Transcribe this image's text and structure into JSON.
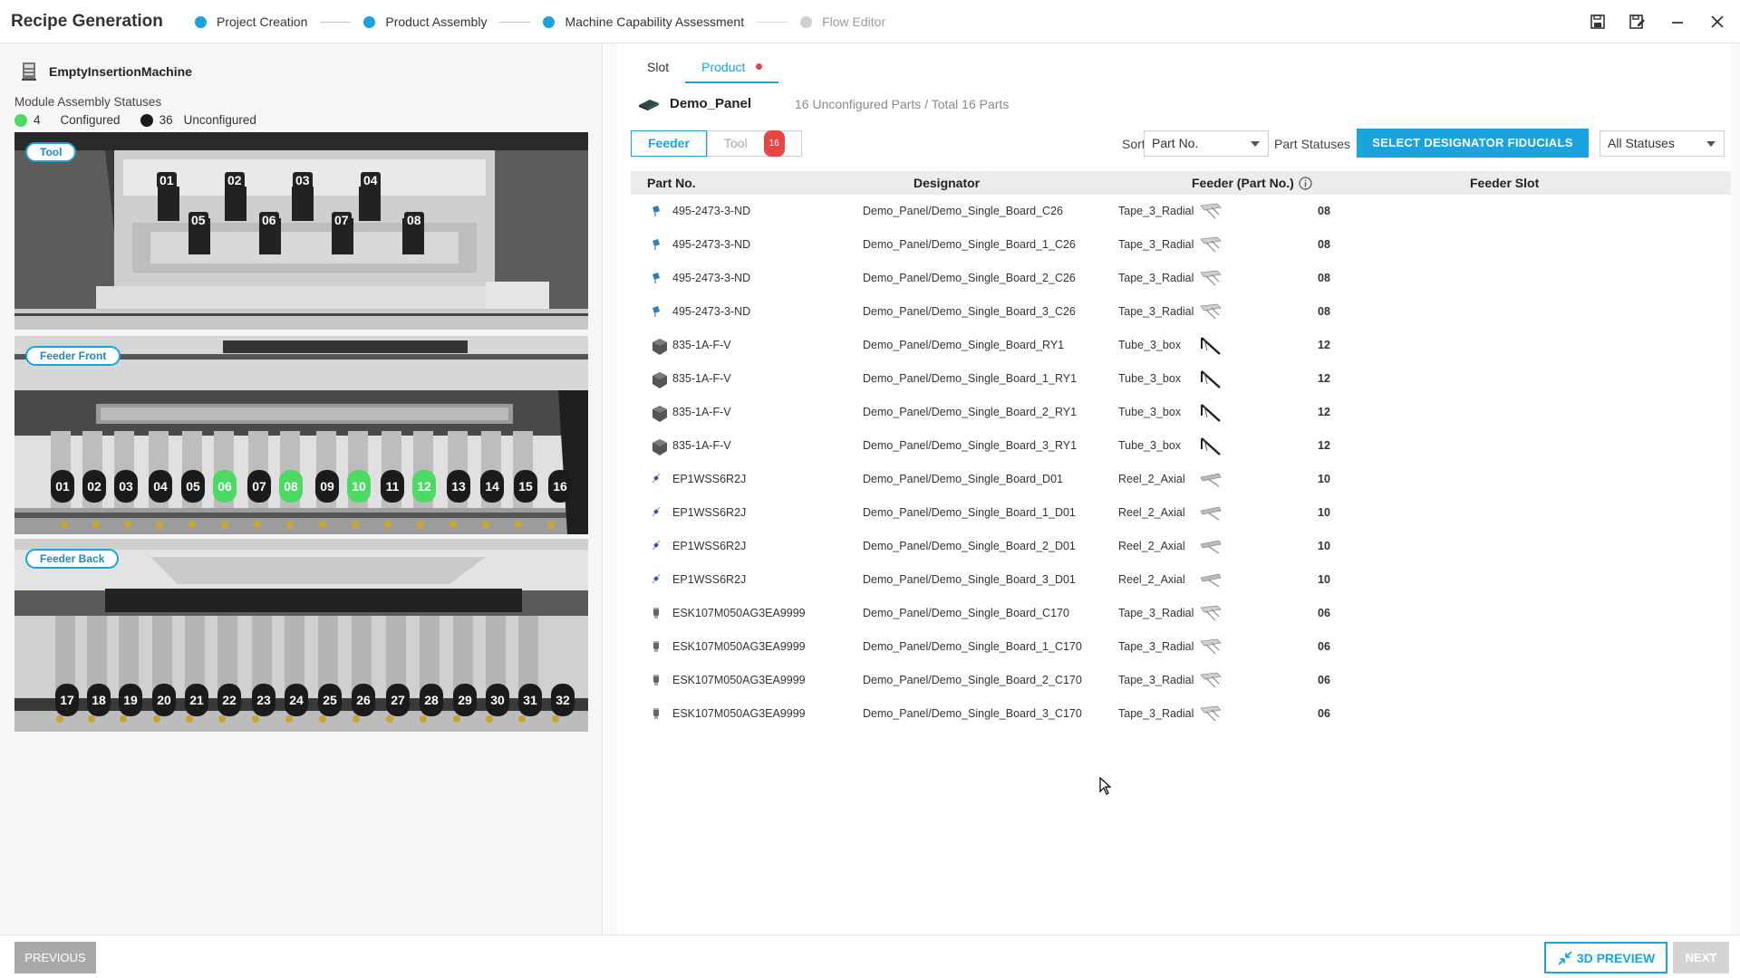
{
  "header": {
    "title": "Recipe Generation",
    "steps": [
      {
        "label": "Project Creation",
        "state": "done"
      },
      {
        "label": "Product Assembly",
        "state": "done"
      },
      {
        "label": "Machine Capability Assessment",
        "state": "current"
      },
      {
        "label": "Flow Editor",
        "state": "inactive"
      }
    ],
    "controls": [
      "save-icon",
      "save-as-icon",
      "minimize-icon",
      "close-icon"
    ]
  },
  "left": {
    "machine_name": "EmptyInsertionMachine",
    "status_title": "Module Assembly Statuses",
    "configured_count": "4",
    "configured_label": "Configured",
    "unconfigured_count": "36",
    "unconfigured_label": "Unconfigured",
    "configured_color": "#4cd964",
    "unconfigured_color": "#1b1b1b",
    "views": {
      "tool": {
        "label": "Tool",
        "slots": [
          "01",
          "02",
          "03",
          "04",
          "05",
          "06",
          "07",
          "08"
        ]
      },
      "front": {
        "label": "Feeder Front",
        "slots": [
          "01",
          "02",
          "03",
          "04",
          "05",
          "06",
          "07",
          "08",
          "09",
          "10",
          "11",
          "12",
          "13",
          "14",
          "15",
          "16"
        ],
        "configured": [
          "06",
          "08",
          "10",
          "12"
        ]
      },
      "back": {
        "label": "Feeder Back",
        "slots": [
          "17",
          "18",
          "19",
          "20",
          "21",
          "22",
          "23",
          "24",
          "25",
          "26",
          "27",
          "28",
          "29",
          "30",
          "31",
          "32"
        ]
      }
    }
  },
  "right": {
    "tabs": [
      {
        "label": "Slot"
      },
      {
        "label": "Product"
      }
    ],
    "panel_name": "Demo_Panel",
    "parts_summary": "16 Unconfigured Parts / Total 16 Parts",
    "toggle": {
      "feeder": "Feeder",
      "tool": "Tool",
      "tool_count": "16"
    },
    "sort_label": "Sort",
    "sort_value": "Part No.",
    "statuses_label": "Part Statuses",
    "select_button": "SELECT DESIGNATOR FIDUCIALS",
    "status_filter": "All Statuses",
    "columns": {
      "part": "Part No.",
      "designator": "Designator",
      "feeder": "Feeder (Part No.)",
      "slot": "Feeder Slot"
    },
    "rows": [
      {
        "part": "495-2473-3-ND",
        "designator": "Demo_Panel/Demo_Single_Board_C26",
        "feeder": "Tape_3_Radial",
        "slot": "08",
        "icon": "capacitor-icon",
        "ficon": "tape-icon"
      },
      {
        "part": "495-2473-3-ND",
        "designator": "Demo_Panel/Demo_Single_Board_1_C26",
        "feeder": "Tape_3_Radial",
        "slot": "08",
        "icon": "capacitor-icon",
        "ficon": "tape-icon"
      },
      {
        "part": "495-2473-3-ND",
        "designator": "Demo_Panel/Demo_Single_Board_2_C26",
        "feeder": "Tape_3_Radial",
        "slot": "08",
        "icon": "capacitor-icon",
        "ficon": "tape-icon"
      },
      {
        "part": "495-2473-3-ND",
        "designator": "Demo_Panel/Demo_Single_Board_3_C26",
        "feeder": "Tape_3_Radial",
        "slot": "08",
        "icon": "capacitor-icon",
        "ficon": "tape-icon"
      },
      {
        "part": "835-1A-F-V",
        "designator": "Demo_Panel/Demo_Single_Board_RY1",
        "feeder": "Tube_3_box",
        "slot": "12",
        "icon": "relay-icon",
        "ficon": "tube-icon"
      },
      {
        "part": "835-1A-F-V",
        "designator": "Demo_Panel/Demo_Single_Board_1_RY1",
        "feeder": "Tube_3_box",
        "slot": "12",
        "icon": "relay-icon",
        "ficon": "tube-icon"
      },
      {
        "part": "835-1A-F-V",
        "designator": "Demo_Panel/Demo_Single_Board_2_RY1",
        "feeder": "Tube_3_box",
        "slot": "12",
        "icon": "relay-icon",
        "ficon": "tube-icon"
      },
      {
        "part": "835-1A-F-V",
        "designator": "Demo_Panel/Demo_Single_Board_3_RY1",
        "feeder": "Tube_3_box",
        "slot": "12",
        "icon": "relay-icon",
        "ficon": "tube-icon"
      },
      {
        "part": "EP1WSS6R2J",
        "designator": "Demo_Panel/Demo_Single_Board_D01",
        "feeder": "Reel_2_Axial",
        "slot": "10",
        "icon": "diode-icon",
        "ficon": "reel-icon"
      },
      {
        "part": "EP1WSS6R2J",
        "designator": "Demo_Panel/Demo_Single_Board_1_D01",
        "feeder": "Reel_2_Axial",
        "slot": "10",
        "icon": "diode-icon",
        "ficon": "reel-icon"
      },
      {
        "part": "EP1WSS6R2J",
        "designator": "Demo_Panel/Demo_Single_Board_2_D01",
        "feeder": "Reel_2_Axial",
        "slot": "10",
        "icon": "diode-icon",
        "ficon": "reel-icon"
      },
      {
        "part": "EP1WSS6R2J",
        "designator": "Demo_Panel/Demo_Single_Board_3_D01",
        "feeder": "Reel_2_Axial",
        "slot": "10",
        "icon": "diode-icon",
        "ficon": "reel-icon"
      },
      {
        "part": "ESK107M050AG3EA9999",
        "designator": "Demo_Panel/Demo_Single_Board_C170",
        "feeder": "Tape_3_Radial",
        "slot": "06",
        "icon": "electrolytic-icon",
        "ficon": "tape-icon"
      },
      {
        "part": "ESK107M050AG3EA9999",
        "designator": "Demo_Panel/Demo_Single_Board_1_C170",
        "feeder": "Tape_3_Radial",
        "slot": "06",
        "icon": "electrolytic-icon",
        "ficon": "tape-icon"
      },
      {
        "part": "ESK107M050AG3EA9999",
        "designator": "Demo_Panel/Demo_Single_Board_2_C170",
        "feeder": "Tape_3_Radial",
        "slot": "06",
        "icon": "electrolytic-icon",
        "ficon": "tape-icon"
      },
      {
        "part": "ESK107M050AG3EA9999",
        "designator": "Demo_Panel/Demo_Single_Board_3_C170",
        "feeder": "Tape_3_Radial",
        "slot": "06",
        "icon": "electrolytic-icon",
        "ficon": "tape-icon"
      }
    ]
  },
  "footer": {
    "previous": "PREVIOUS",
    "preview": "3D PREVIEW",
    "next": "NEXT"
  },
  "colors": {
    "accent": "#1aa3dd",
    "alert": "#e94545"
  }
}
